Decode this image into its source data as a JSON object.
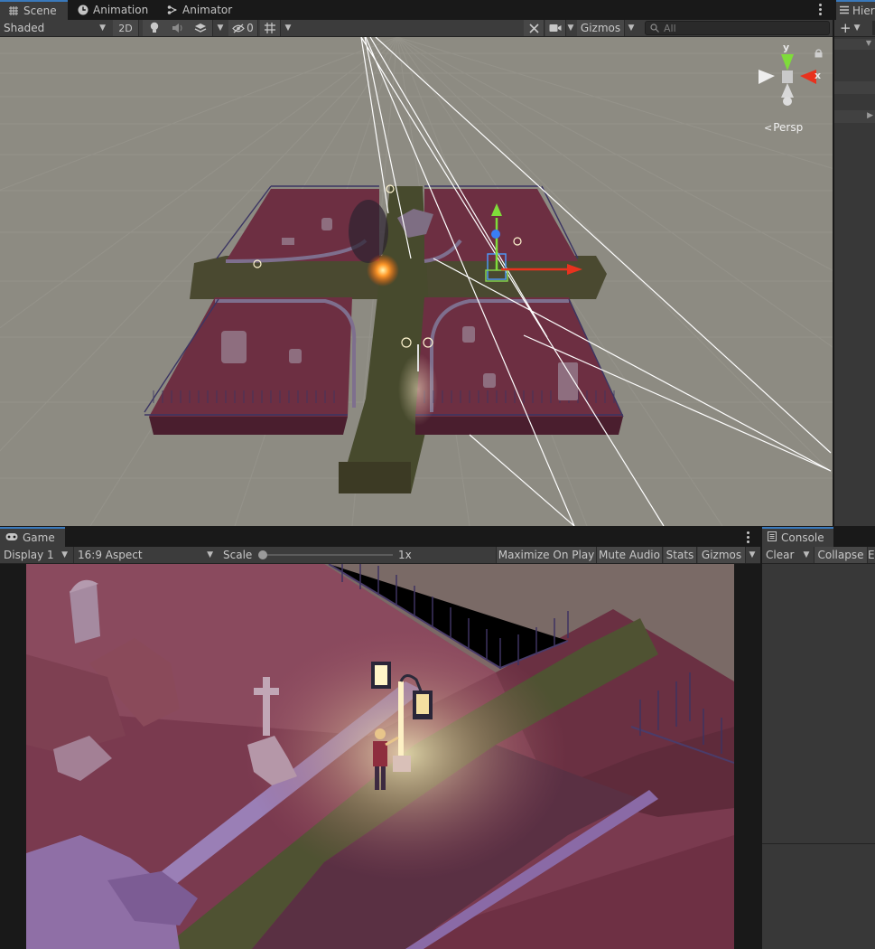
{
  "scene_tabs": [
    {
      "label": "Scene",
      "icon": "grid-icon"
    },
    {
      "label": "Animation",
      "icon": "animation-clock-icon"
    },
    {
      "label": "Animator",
      "icon": "animator-icon"
    }
  ],
  "hierarchy_tab": {
    "label": "Hier"
  },
  "scene_toolbar": {
    "draw_mode": "Shaded",
    "two_d": "2D",
    "hidden_count": "0",
    "gizmos": "Gizmos",
    "search_placeholder": "All"
  },
  "orientation_gizmo": {
    "y": "y",
    "x": "x",
    "projection": "Persp"
  },
  "game_tab": {
    "label": "Game"
  },
  "console_tab": {
    "label": "Console"
  },
  "game_toolbar": {
    "display": "Display 1",
    "aspect": "16:9 Aspect",
    "scale_label": "Scale",
    "scale_value": "1x",
    "maximize": "Maximize On Play",
    "mute": "Mute Audio",
    "stats": "Stats",
    "gizmos": "Gizmos"
  },
  "console_toolbar": {
    "clear": "Clear",
    "collapse": "Collapse"
  },
  "colors": {
    "panel": "#3c3c3c",
    "accent": "#3a79bb",
    "scene_bg": "#8d8b82",
    "ground": "#6d2f42",
    "path": "#4c4a2c",
    "fence": "#5b4a8f"
  }
}
